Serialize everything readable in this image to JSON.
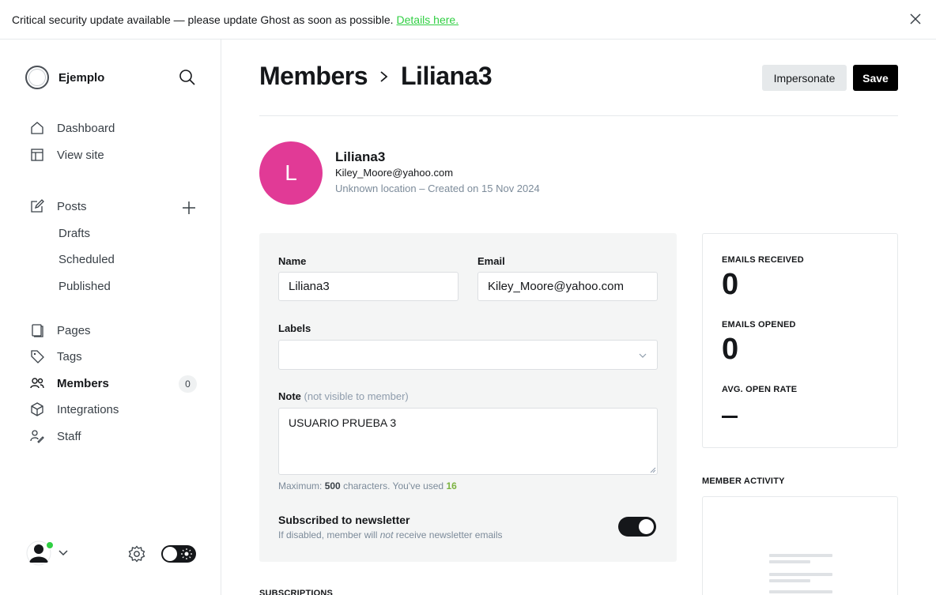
{
  "banner": {
    "text": "Critical security update available — please update Ghost as soon as possible.",
    "link": "Details here."
  },
  "sidebar": {
    "site_name": "Ejemplo",
    "nav": {
      "dashboard": "Dashboard",
      "view_site": "View site",
      "posts": "Posts",
      "drafts": "Drafts",
      "scheduled": "Scheduled",
      "published": "Published",
      "pages": "Pages",
      "tags": "Tags",
      "members": "Members",
      "members_count": "0",
      "integrations": "Integrations",
      "staff": "Staff"
    }
  },
  "header": {
    "breadcrumb_parent": "Members",
    "breadcrumb_current": "Liliana3",
    "impersonate_label": "Impersonate",
    "save_label": "Save"
  },
  "member": {
    "initial": "L",
    "name": "Liliana3",
    "email": "Kiley_Moore@yahoo.com",
    "meta": "Unknown location – Created on 15 Nov 2024",
    "avatar_color": "#e13a96"
  },
  "form": {
    "name_label": "Name",
    "name_value": "Liliana3",
    "email_label": "Email",
    "email_value": "Kiley_Moore@yahoo.com",
    "labels_label": "Labels",
    "note_label": "Note",
    "note_hint": "(not visible to member)",
    "note_value": "USUARIO PRUEBA 3",
    "char_prefix": "Maximum:",
    "char_max": "500",
    "char_mid": "characters. You've used",
    "char_used": "16",
    "newsletter_title": "Subscribed to newsletter",
    "newsletter_desc_pre": "If disabled, member will",
    "newsletter_desc_em": "not",
    "newsletter_desc_post": "receive newsletter emails",
    "newsletter_enabled": true
  },
  "stats": {
    "emails_received_label": "EMAILS RECEIVED",
    "emails_received_value": "0",
    "emails_opened_label": "EMAILS OPENED",
    "emails_opened_value": "0",
    "open_rate_label": "AVG. OPEN RATE"
  },
  "activity": {
    "title": "MEMBER ACTIVITY"
  },
  "subscriptions": {
    "title": "SUBSCRIPTIONS"
  },
  "colors": {
    "accent_green": "#30cf43",
    "online_dot": "#30cf43",
    "used_count": "#7cb342"
  },
  "icons": [
    "close-icon",
    "search-icon",
    "home-icon",
    "layout-icon",
    "edit-icon",
    "plus-icon",
    "page-icon",
    "tag-icon",
    "members-icon",
    "box-icon",
    "staff-icon",
    "gear-icon",
    "chevron-down-icon",
    "sun-icon"
  ]
}
